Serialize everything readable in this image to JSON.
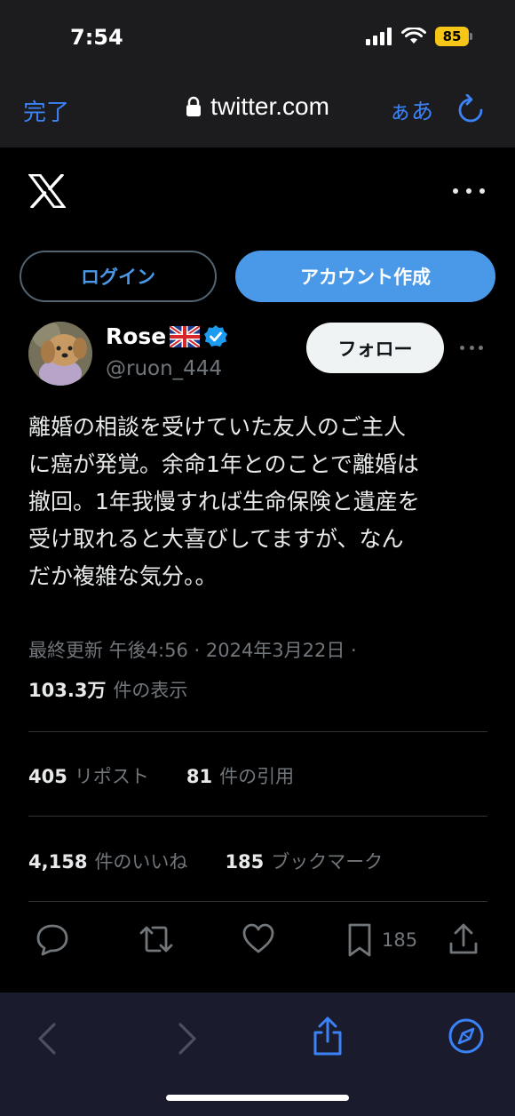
{
  "status": {
    "time": "7:54",
    "battery": "85"
  },
  "safari": {
    "done_label": "完了",
    "url": "twitter.com",
    "aa_label": "ぁあ"
  },
  "page": {
    "login_label": "ログイン",
    "signup_label": "アカウント作成"
  },
  "tweet": {
    "name": "Rose",
    "flag": "🇬🇧",
    "handle": "@ruon_444",
    "follow_label": "フォロー",
    "text": "離婚の相談を受けていた友人のご主人\nに癌が発覚。余命1年とのことで離婚は\n撤回。1年我慢すれば生命保険と遺産を\n受け取れると大喜びしてますが、なん\nだか複雑な気分。。",
    "meta": "最終更新 午後4:56 · 2024年3月22日 ·",
    "views_count": "103.3万",
    "views_label": "件の表示",
    "stats1": [
      {
        "num": "405",
        "label": "リポスト"
      },
      {
        "num": "81",
        "label": "件の引用"
      }
    ],
    "stats2": [
      {
        "num": "4,158",
        "label": "件のいいね"
      },
      {
        "num": "185",
        "label": "ブックマーク"
      }
    ],
    "bookmark_count": "185"
  },
  "colors": {
    "accent": "#4a99e9",
    "safari_blue": "#3b82f6",
    "verified": "#1d9bf0",
    "muted": "#71767b"
  }
}
